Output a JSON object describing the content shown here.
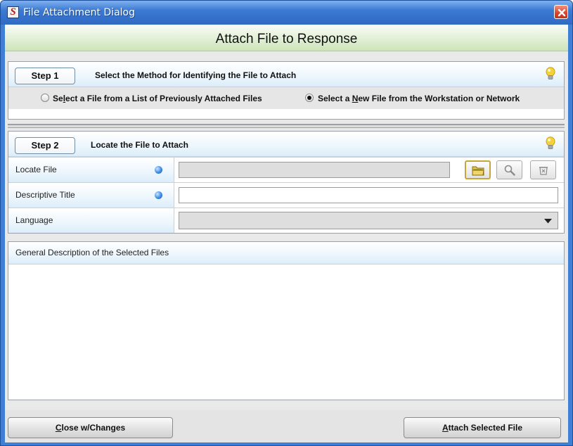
{
  "window": {
    "title": "File Attachment Dialog",
    "icon_letter": "S"
  },
  "header": {
    "title": "Attach File to Response"
  },
  "step1": {
    "button_label": "Step 1",
    "text": "Select the Method for Identifying the File to Attach",
    "options": [
      {
        "pre": "Se",
        "mnemonic": "l",
        "post": "ect a File from a List of Previously Attached Files",
        "checked": false
      },
      {
        "pre": "Select a ",
        "mnemonic": "N",
        "post": "ew File from the Workstation or Network",
        "checked": true
      }
    ]
  },
  "step2": {
    "button_label": "Step 2",
    "text": "Locate the File to Attach",
    "fields": {
      "locate_file": {
        "label": "Locate File",
        "value": "",
        "required": true
      },
      "descriptive_title": {
        "label": "Descriptive Title",
        "value": "",
        "required": true
      },
      "language": {
        "label": "Language",
        "value": ""
      }
    }
  },
  "description": {
    "label": "General Description of the Selected Files",
    "value": ""
  },
  "footer": {
    "close_button": {
      "mnemonic": "C",
      "rest": "lose w/Changes"
    },
    "attach_button": {
      "mnemonic": "A",
      "rest": "ttach Selected File"
    }
  },
  "icons": {
    "close": "close-icon",
    "hint": "lightbulb-icon",
    "browse": "folder-icon",
    "view": "magnifier-icon",
    "clear": "clear-icon",
    "dropdown": "chevron-down-icon",
    "required": "required-dot-icon"
  },
  "colors": {
    "titlebar": "#3c7ad3",
    "header_band": "#dfeed2",
    "section_header": "#dcedf9",
    "required_dot": "#3b8ae6",
    "bulb": "#f5d23a"
  }
}
